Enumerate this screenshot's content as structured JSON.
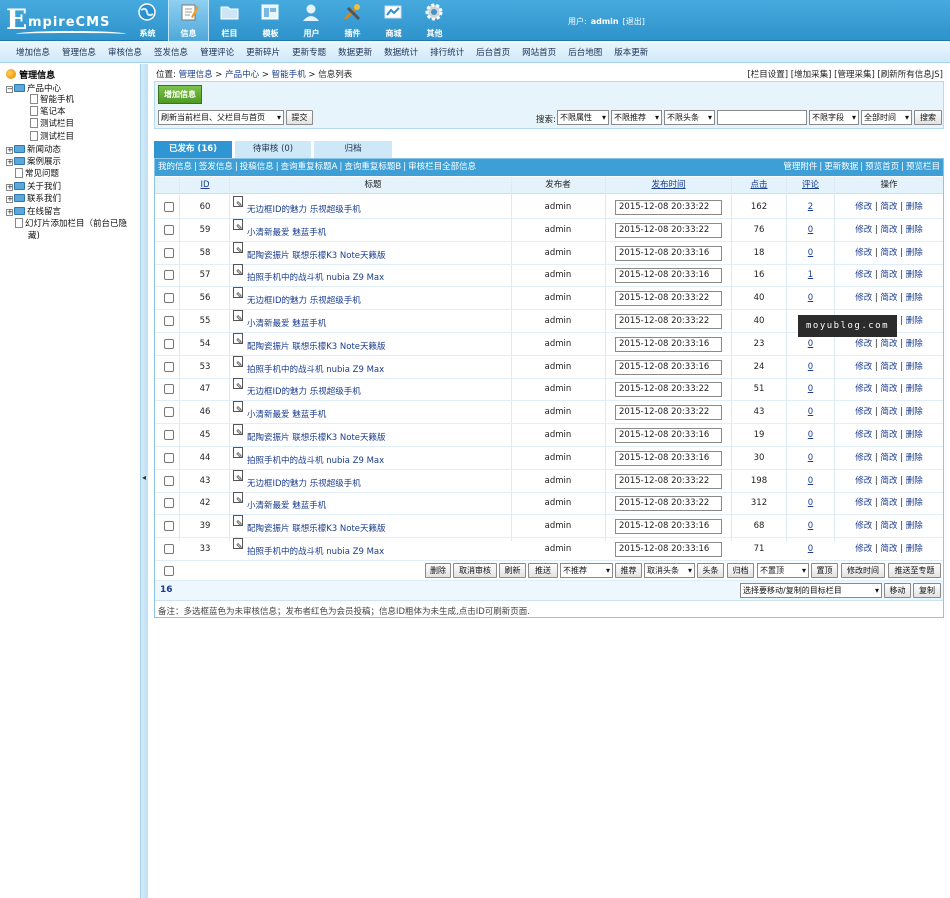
{
  "logo": {
    "text": "EmpireCMS"
  },
  "mainnav": [
    {
      "label": "系统",
      "icon": "globe-icon"
    },
    {
      "label": "信息",
      "icon": "edit-icon",
      "active": true
    },
    {
      "label": "栏目",
      "icon": "folder-icon"
    },
    {
      "label": "模板",
      "icon": "template-icon"
    },
    {
      "label": "用户",
      "icon": "user-icon"
    },
    {
      "label": "插件",
      "icon": "tools-icon"
    },
    {
      "label": "商城",
      "icon": "shop-icon"
    },
    {
      "label": "其他",
      "icon": "gear-icon"
    }
  ],
  "user": {
    "prefix": "用户:",
    "name": "admin",
    "logout": "[退出]"
  },
  "submenu": [
    "增加信息",
    "管理信息",
    "审核信息",
    "签发信息",
    "管理评论",
    "更新碎片",
    "更新专题",
    "数据更新",
    "数据统计",
    "排行统计",
    "后台首页",
    "网站首页",
    "后台地图",
    "版本更新"
  ],
  "tree": {
    "header": "管理信息",
    "nodes": [
      {
        "label": "产品中心",
        "toggle": "−",
        "icon": "folder"
      },
      {
        "label": "智能手机",
        "icon": "doc"
      },
      {
        "label": "笔记本",
        "icon": "doc"
      },
      {
        "label": "测试栏目",
        "icon": "doc"
      },
      {
        "label": "测试栏目",
        "icon": "doc"
      },
      {
        "label": "新闻动态",
        "toggle": "+",
        "icon": "folder"
      },
      {
        "label": "案例展示",
        "toggle": "+",
        "icon": "folder"
      },
      {
        "label": "常见问题",
        "icon": "doc"
      },
      {
        "label": "关于我们",
        "toggle": "+",
        "icon": "folder"
      },
      {
        "label": "联系我们",
        "toggle": "+",
        "icon": "folder"
      },
      {
        "label": "在线留言",
        "toggle": "+",
        "icon": "folder"
      },
      {
        "label": "幻灯片添加栏目（前台已隐",
        "icon": "doc"
      },
      {
        "label": "藏)",
        "icon": ""
      }
    ]
  },
  "breadcrumb": {
    "prefix": "位置:",
    "items": [
      "管理信息",
      "产品中心",
      "智能手机"
    ],
    "current": "信息列表"
  },
  "toplinks": "[栏目设置] [增加采集] [管理采集] [刷新所有信息JS]",
  "toolbar": {
    "add_label": "增加信息",
    "refresh_select": "刷新当前栏目、父栏目与首页",
    "submit_label": "提交",
    "search_label": "搜索:",
    "filters": [
      "不限属性",
      "不限推荐",
      "不限头条"
    ],
    "field_select": "不限字段",
    "time_select": "全部时间",
    "search_button": "搜索",
    "search_value": ""
  },
  "tabs": [
    "已发布 (16)",
    "待审核 (0)",
    "归档"
  ],
  "subnav_left": [
    "我的信息",
    "签发信息",
    "投稿信息",
    "查询重复标题A",
    "查询重复标题B",
    "审核栏目全部信息"
  ],
  "subnav_right": [
    "管理附件",
    "更新数据",
    "预览首页",
    "预览栏目"
  ],
  "columns": {
    "id": "ID",
    "title": "标题",
    "publisher": "发布者",
    "time": "发布时间",
    "clicks": "点击",
    "comments": "评论",
    "ops": "操作"
  },
  "rows": [
    {
      "id": "60",
      "title": "无边框ID的魅力 乐视超级手机",
      "publisher": "admin",
      "time": "2015-12-08 20:33:22",
      "clicks": "162",
      "comments": "2"
    },
    {
      "id": "59",
      "title": "小清新最爱 魅蓝手机",
      "publisher": "admin",
      "time": "2015-12-08 20:33:22",
      "clicks": "76",
      "comments": "0"
    },
    {
      "id": "58",
      "title": "配陶瓷振片 联想乐檬K3 Note天籁版",
      "publisher": "admin",
      "time": "2015-12-08 20:33:16",
      "clicks": "18",
      "comments": "0"
    },
    {
      "id": "57",
      "title": "拍照手机中的战斗机 nubia Z9 Max",
      "publisher": "admin",
      "time": "2015-12-08 20:33:16",
      "clicks": "16",
      "comments": "1"
    },
    {
      "id": "56",
      "title": "无边框ID的魅力 乐视超级手机",
      "publisher": "admin",
      "time": "2015-12-08 20:33:22",
      "clicks": "40",
      "comments": "0"
    },
    {
      "id": "55",
      "title": "小清新最爱 魅蓝手机",
      "publisher": "admin",
      "time": "2015-12-08 20:33:22",
      "clicks": "40",
      "comments": "0"
    },
    {
      "id": "54",
      "title": "配陶瓷振片 联想乐檬K3 Note天籁版",
      "publisher": "admin",
      "time": "2015-12-08 20:33:16",
      "clicks": "23",
      "comments": "0"
    },
    {
      "id": "53",
      "title": "拍照手机中的战斗机 nubia Z9 Max",
      "publisher": "admin",
      "time": "2015-12-08 20:33:16",
      "clicks": "24",
      "comments": "0"
    },
    {
      "id": "47",
      "title": "无边框ID的魅力 乐视超级手机",
      "publisher": "admin",
      "time": "2015-12-08 20:33:22",
      "clicks": "51",
      "comments": "0"
    },
    {
      "id": "46",
      "title": "小清新最爱 魅蓝手机",
      "publisher": "admin",
      "time": "2015-12-08 20:33:22",
      "clicks": "43",
      "comments": "0"
    },
    {
      "id": "45",
      "title": "配陶瓷振片 联想乐檬K3 Note天籁版",
      "publisher": "admin",
      "time": "2015-12-08 20:33:16",
      "clicks": "19",
      "comments": "0"
    },
    {
      "id": "44",
      "title": "拍照手机中的战斗机 nubia Z9 Max",
      "publisher": "admin",
      "time": "2015-12-08 20:33:16",
      "clicks": "30",
      "comments": "0"
    },
    {
      "id": "43",
      "title": "无边框ID的魅力 乐视超级手机",
      "publisher": "admin",
      "time": "2015-12-08 20:33:22",
      "clicks": "198",
      "comments": "0"
    },
    {
      "id": "42",
      "title": "小清新最爱 魅蓝手机",
      "publisher": "admin",
      "time": "2015-12-08 20:33:22",
      "clicks": "312",
      "comments": "0"
    },
    {
      "id": "39",
      "title": "配陶瓷振片 联想乐檬K3 Note天籁版",
      "publisher": "admin",
      "time": "2015-12-08 20:33:16",
      "clicks": "68",
      "comments": "0"
    },
    {
      "id": "33",
      "title": "拍照手机中的战斗机 nubia Z9 Max",
      "publisher": "admin",
      "time": "2015-12-08 20:33:16",
      "clicks": "71",
      "comments": "0"
    }
  ],
  "row_ops": {
    "edit": "修改",
    "quick_edit": "简改",
    "delete": "删除",
    "sep": "|"
  },
  "bulk": {
    "delete": "删除",
    "unapprove": "取消审核",
    "refresh": "刷新",
    "push": "推送",
    "recommend_select": "不推荐",
    "recommend": "推荐",
    "headline_select": "取消头条",
    "headline": "头条",
    "archive": "归档",
    "top_select": "不置顶",
    "top": "置顶",
    "modify_time": "修改时间",
    "push_topic": "推送至专题"
  },
  "pager": {
    "count": "16",
    "move_select": "选择要移动/复制的目标栏目",
    "move": "移动",
    "copy": "复制"
  },
  "note": "备注：多选框蓝色为未审核信息；发布者红色为会员投稿；信息ID粗体为未生成,点击ID可刷新页面.",
  "watermark": "moyublog.com",
  "sidebar_toggle": "◂"
}
